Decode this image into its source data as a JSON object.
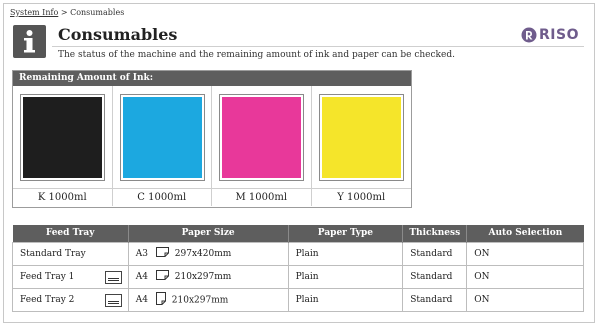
{
  "breadcrumb": {
    "parent": "System Info",
    "separator": " > ",
    "current": "Consumables"
  },
  "header": {
    "title": "Consumables",
    "description": "The status of the machine and the remaining amount of ink and paper can be checked.",
    "logo_text": "RISO"
  },
  "ink": {
    "heading": "Remaining Amount of Ink:",
    "items": [
      {
        "label": "K  1000ml",
        "color": "#1e1e1e"
      },
      {
        "label": "C  1000ml",
        "color": "#1ca8e0"
      },
      {
        "label": "M 1000ml",
        "color": "#e8389a"
      },
      {
        "label": "Y  1000ml",
        "color": "#f5e52a"
      }
    ]
  },
  "feed": {
    "headers": [
      "Feed Tray",
      "Paper Size",
      "Paper Type",
      "Thickness",
      "Auto Selection"
    ],
    "rows": [
      {
        "tray": "Standard Tray",
        "size_name": "A3",
        "orientation": "landscape",
        "dimensions": "297x420mm",
        "type": "Plain",
        "thickness": "Standard",
        "auto": "ON",
        "tray_icon": false
      },
      {
        "tray": "Feed Tray 1",
        "size_name": "A4",
        "orientation": "landscape",
        "dimensions": "210x297mm",
        "type": "Plain",
        "thickness": "Standard",
        "auto": "ON",
        "tray_icon": true
      },
      {
        "tray": "Feed Tray 2",
        "size_name": "A4",
        "orientation": "portrait",
        "dimensions": "210x297mm",
        "type": "Plain",
        "thickness": "Standard",
        "auto": "ON",
        "tray_icon": true
      }
    ]
  }
}
